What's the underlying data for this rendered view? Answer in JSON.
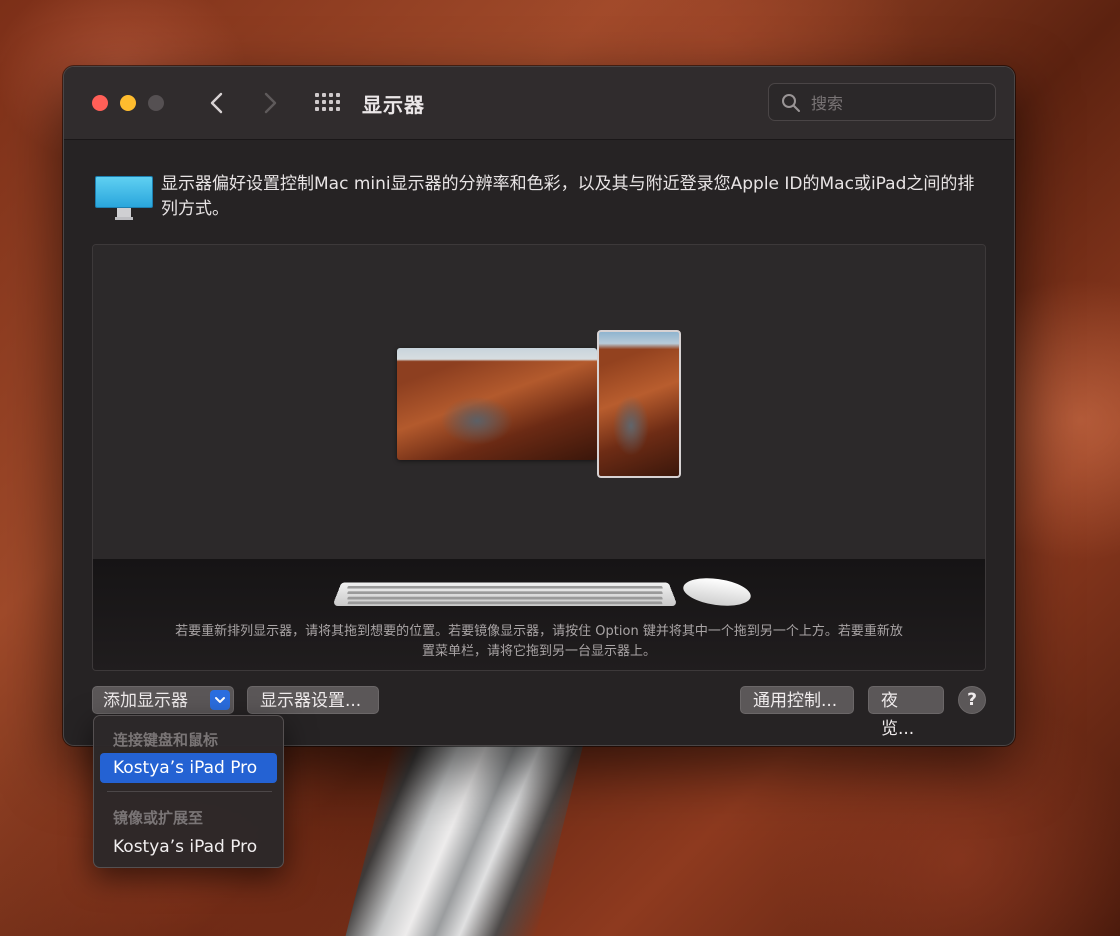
{
  "window": {
    "title": "显示器",
    "search_placeholder": "搜索"
  },
  "description": "显示器偏好设置控制Mac mini显示器的分辨率和色彩，以及其与附近登录您Apple ID的Mac或iPad之间的排列方式。",
  "arrangement": {
    "hint": "若要重新排列显示器，请将其拖到想要的位置。若要镜像显示器，请按住 Option 键并将其中一个拖到另一个上方。若要重新放置菜单栏，请将它拖到另一台显示器上。"
  },
  "buttons": {
    "add_display": "添加显示器",
    "display_settings": "显示器设置...",
    "universal_control": "通用控制...",
    "night_shift": "夜览...",
    "help": "?"
  },
  "menu": {
    "section_link": "连接键盘和鼠标",
    "section_mirror": "镜像或扩展至",
    "items": [
      {
        "label": "Kostya’s iPad Pro",
        "selected": true
      },
      {
        "label": "Kostya’s iPad Pro",
        "selected": false
      }
    ]
  },
  "colors": {
    "accent": "#2462d3",
    "close": "#ff5f57",
    "minimize": "#febc2e"
  },
  "icons": [
    "chevron-left-icon",
    "chevron-right-icon",
    "grid-icon",
    "search-icon",
    "display-icon",
    "keyboard-icon",
    "mouse-icon",
    "chevron-down-icon",
    "help-icon"
  ]
}
